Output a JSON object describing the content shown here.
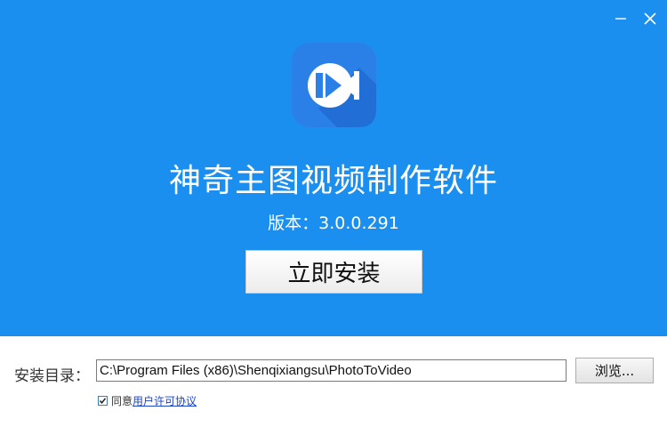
{
  "app": {
    "title": "神奇主图视频制作软件",
    "version": "版本：3.0.0.291"
  },
  "icons": {
    "minimize": "minimize-icon",
    "close": "close-icon",
    "logo": "play-logo-icon",
    "checkbox": "checkmark-icon"
  },
  "colors": {
    "header_bg": "#1a8ff0",
    "logo_bg": "#2b80e8",
    "link": "#1a44c8"
  },
  "actions": {
    "install_label": "立即安装",
    "browse_label": "浏览..."
  },
  "install_dir": {
    "label": "安装目录：",
    "value": "C:\\Program Files (x86)\\Shenqixiangsu\\PhotoToVideo"
  },
  "agreement": {
    "checked": true,
    "prefix": "同意",
    "link_text": "用户许可协议"
  }
}
